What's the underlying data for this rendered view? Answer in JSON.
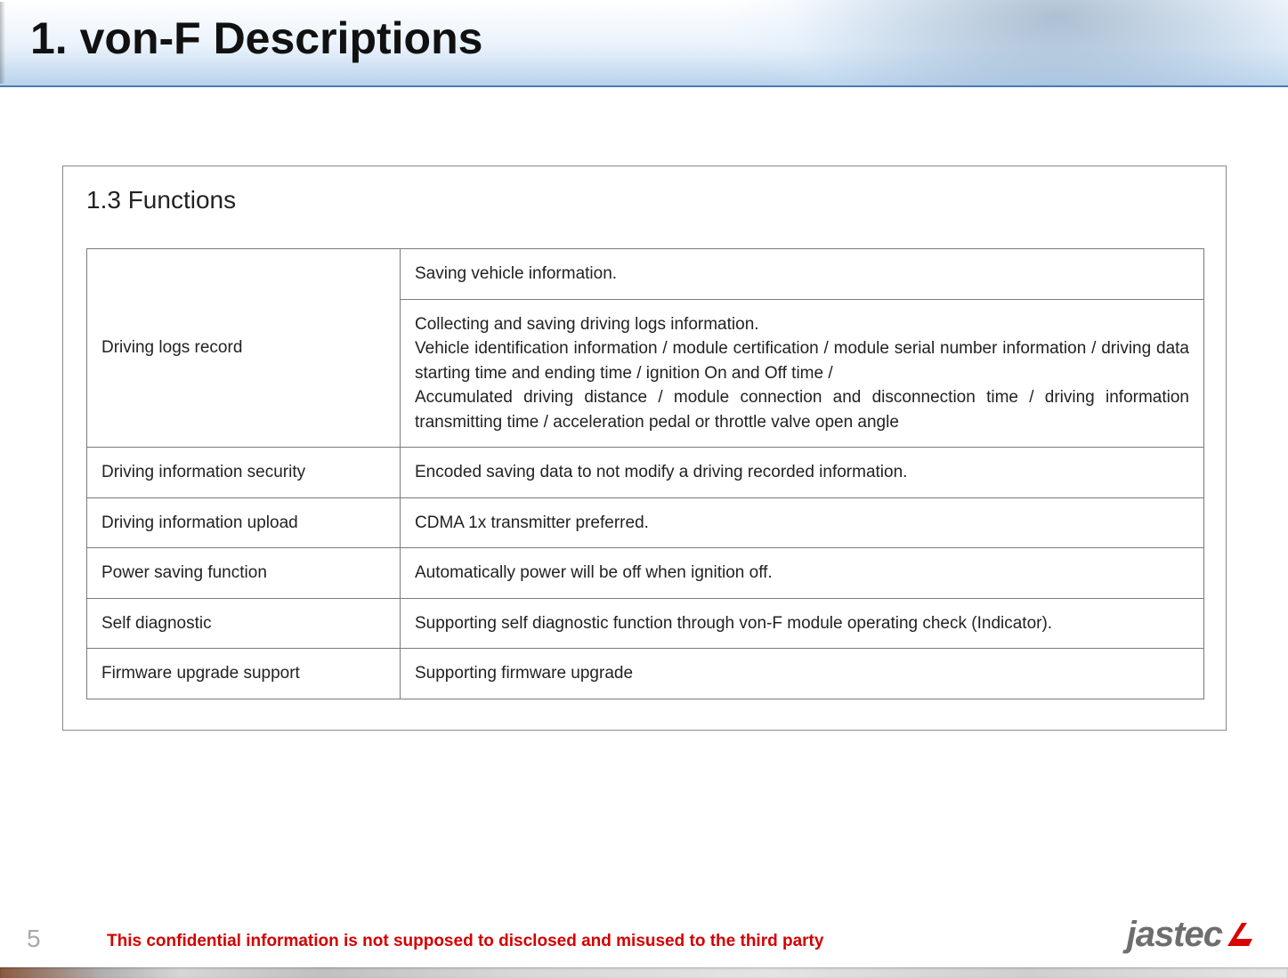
{
  "title": "1. von-F Descriptions",
  "section": {
    "heading": "1.3 Functions"
  },
  "functions_table": {
    "rows": [
      {
        "label": "Driving logs record",
        "rowspan": 2,
        "desc1": "Saving vehicle information.",
        "desc2": "Collecting and saving driving logs information.\nVehicle identification information / module certification / module serial number information / driving data starting time and ending time / ignition On and  Off time /\nAccumulated driving distance / module connection and disconnection time / driving information transmitting time / acceleration pedal or throttle valve open angle"
      },
      {
        "label": "Driving information security",
        "desc": "Encoded saving data to not modify a driving recorded information."
      },
      {
        "label": "Driving information upload",
        "desc": "CDMA 1x transmitter preferred."
      },
      {
        "label": "Power saving function",
        "desc": "Automatically power will be off when ignition off."
      },
      {
        "label": "Self diagnostic",
        "desc": "Supporting self diagnostic function through von-F module operating check (Indicator)."
      },
      {
        "label": "Firmware upgrade support",
        "desc": "Supporting firmware upgrade"
      }
    ]
  },
  "footer": {
    "page_number": "5",
    "confidential_text": "This confidential information is not supposed to disclosed and misused to the third party",
    "logo_text": "jastec"
  }
}
